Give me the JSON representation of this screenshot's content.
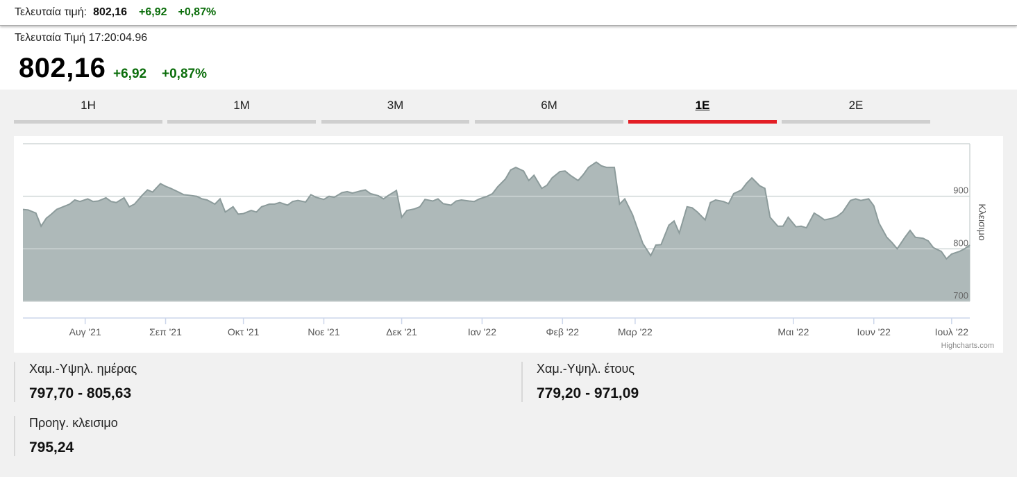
{
  "top_bar": {
    "label": "Τελευταία τιμή:",
    "value": "802,16",
    "change": "+6,92",
    "change_pct": "+0,87%"
  },
  "quote": {
    "last_time": "Τελευταία Τιμή 17:20:04.96",
    "price": "802,16",
    "change": "+6,92",
    "change_pct": "+0,87%"
  },
  "tabs": [
    {
      "label": "1H",
      "active": false
    },
    {
      "label": "1M",
      "active": false
    },
    {
      "label": "3M",
      "active": false
    },
    {
      "label": "6M",
      "active": false
    },
    {
      "label": "1E",
      "active": true
    },
    {
      "label": "2E",
      "active": false
    }
  ],
  "chart_data": {
    "type": "area",
    "ylabel": "Κλεισιμο",
    "ylim": [
      700,
      1000
    ],
    "y_ticks": [
      "700",
      "800",
      "900"
    ],
    "x_ticks": [
      "Αυγ '21",
      "Σεπ '21",
      "Οκτ '21",
      "Νοε '21",
      "Δεκ '21",
      "Ιαν '22",
      "Φεβ '22",
      "Μαρ '22",
      "Μαι '22",
      "Ιουν '22",
      "Ιουλ '22"
    ],
    "x_tick_dates": [
      "2021-08-01",
      "2021-09-01",
      "2021-10-01",
      "2021-11-01",
      "2021-12-01",
      "2022-01-01",
      "2022-02-01",
      "2022-03-01",
      "2022-05-01",
      "2022-06-01",
      "2022-07-01"
    ],
    "grid": true,
    "colors": {
      "fill": "#aeb9b9",
      "line": "#8c9b9b",
      "grid": "#cfd6d6"
    },
    "credit": "Highcharts.com",
    "series": [
      {
        "dates": [
          "2021-07-08",
          "2021-07-10",
          "2021-07-13",
          "2021-07-15",
          "2021-07-17",
          "2021-07-19",
          "2021-07-21",
          "2021-07-23",
          "2021-07-26",
          "2021-07-28",
          "2021-07-30",
          "2021-08-02",
          "2021-08-04",
          "2021-08-06",
          "2021-08-09",
          "2021-08-11",
          "2021-08-13",
          "2021-08-16",
          "2021-08-18",
          "2021-08-20",
          "2021-08-23",
          "2021-08-25",
          "2021-08-27",
          "2021-08-30",
          "2021-09-01",
          "2021-09-03",
          "2021-09-06",
          "2021-09-08",
          "2021-09-10",
          "2021-09-13",
          "2021-09-15",
          "2021-09-17",
          "2021-09-20",
          "2021-09-22",
          "2021-09-24",
          "2021-09-27",
          "2021-09-29",
          "2021-10-01",
          "2021-10-04",
          "2021-10-06",
          "2021-10-08",
          "2021-10-11",
          "2021-10-13",
          "2021-10-15",
          "2021-10-18",
          "2021-10-20",
          "2021-10-22",
          "2021-10-25",
          "2021-10-27",
          "2021-10-29",
          "2021-11-01",
          "2021-11-03",
          "2021-11-05",
          "2021-11-08",
          "2021-11-10",
          "2021-11-12",
          "2021-11-15",
          "2021-11-17",
          "2021-11-19",
          "2021-11-22",
          "2021-11-24",
          "2021-11-26",
          "2021-11-29",
          "2021-12-01",
          "2021-12-03",
          "2021-12-06",
          "2021-12-08",
          "2021-12-10",
          "2021-12-13",
          "2021-12-15",
          "2021-12-17",
          "2021-12-20",
          "2021-12-22",
          "2021-12-24",
          "2021-12-27",
          "2021-12-29",
          "2021-12-31",
          "2022-01-03",
          "2022-01-05",
          "2022-01-07",
          "2022-01-10",
          "2022-01-12",
          "2022-01-14",
          "2022-01-17",
          "2022-01-19",
          "2022-01-21",
          "2022-01-24",
          "2022-01-26",
          "2022-01-28",
          "2022-01-31",
          "2022-02-02",
          "2022-02-04",
          "2022-02-07",
          "2022-02-09",
          "2022-02-11",
          "2022-02-14",
          "2022-02-16",
          "2022-02-18",
          "2022-02-21",
          "2022-02-23",
          "2022-02-25",
          "2022-02-28",
          "2022-03-02",
          "2022-03-04",
          "2022-03-07",
          "2022-03-09",
          "2022-03-11",
          "2022-03-14",
          "2022-03-16",
          "2022-03-18",
          "2022-03-21",
          "2022-03-23",
          "2022-03-25",
          "2022-03-28",
          "2022-03-30",
          "2022-04-01",
          "2022-04-04",
          "2022-04-06",
          "2022-04-08",
          "2022-04-11",
          "2022-04-13",
          "2022-04-15",
          "2022-04-18",
          "2022-04-20",
          "2022-04-22",
          "2022-04-25",
          "2022-04-27",
          "2022-04-29",
          "2022-05-02",
          "2022-05-04",
          "2022-05-06",
          "2022-05-09",
          "2022-05-11",
          "2022-05-13",
          "2022-05-16",
          "2022-05-18",
          "2022-05-20",
          "2022-05-23",
          "2022-05-25",
          "2022-05-27",
          "2022-05-30",
          "2022-06-01",
          "2022-06-03",
          "2022-06-06",
          "2022-06-08",
          "2022-06-10",
          "2022-06-13",
          "2022-06-15",
          "2022-06-17",
          "2022-06-20",
          "2022-06-22",
          "2022-06-24",
          "2022-06-27",
          "2022-06-29",
          "2022-07-01",
          "2022-07-04",
          "2022-07-06",
          "2022-07-08"
        ],
        "values": [
          875,
          874,
          868,
          843,
          858,
          866,
          875,
          879,
          885,
          893,
          890,
          895,
          890,
          891,
          897,
          890,
          888,
          897,
          880,
          885,
          902,
          912,
          908,
          924,
          919,
          915,
          908,
          903,
          902,
          900,
          895,
          893,
          885,
          895,
          870,
          880,
          866,
          867,
          873,
          870,
          880,
          885,
          885,
          888,
          883,
          890,
          892,
          889,
          903,
          898,
          894,
          900,
          898,
          907,
          909,
          906,
          910,
          912,
          905,
          901,
          895,
          902,
          911,
          860,
          873,
          876,
          880,
          894,
          891,
          895,
          886,
          883,
          891,
          893,
          891,
          890,
          895,
          900,
          905,
          918,
          933,
          950,
          955,
          948,
          930,
          940,
          915,
          921,
          935,
          947,
          948,
          940,
          930,
          941,
          955,
          965,
          958,
          955,
          955,
          885,
          895,
          865,
          837,
          810,
          787,
          807,
          808,
          845,
          853,
          830,
          880,
          878,
          870,
          855,
          888,
          893,
          890,
          886,
          905,
          912,
          925,
          935,
          920,
          915,
          860,
          843,
          843,
          860,
          842,
          843,
          840,
          868,
          862,
          855,
          858,
          862,
          870,
          892,
          895,
          892,
          895,
          882,
          849,
          822,
          812,
          800,
          822,
          835,
          822,
          820,
          815,
          802,
          795,
          781,
          790,
          795,
          800,
          807,
          803,
          800,
          803,
          807
        ]
      }
    ]
  },
  "stats": [
    {
      "label": "Χαμ.-Υψηλ. ημέρας",
      "value": "797,70 - 805,63"
    },
    {
      "label": "Χαμ.-Υψηλ. έτους",
      "value": "779,20 - 971,09"
    },
    {
      "label": "Προηγ. κλεισιμο",
      "value": "795,24"
    }
  ]
}
